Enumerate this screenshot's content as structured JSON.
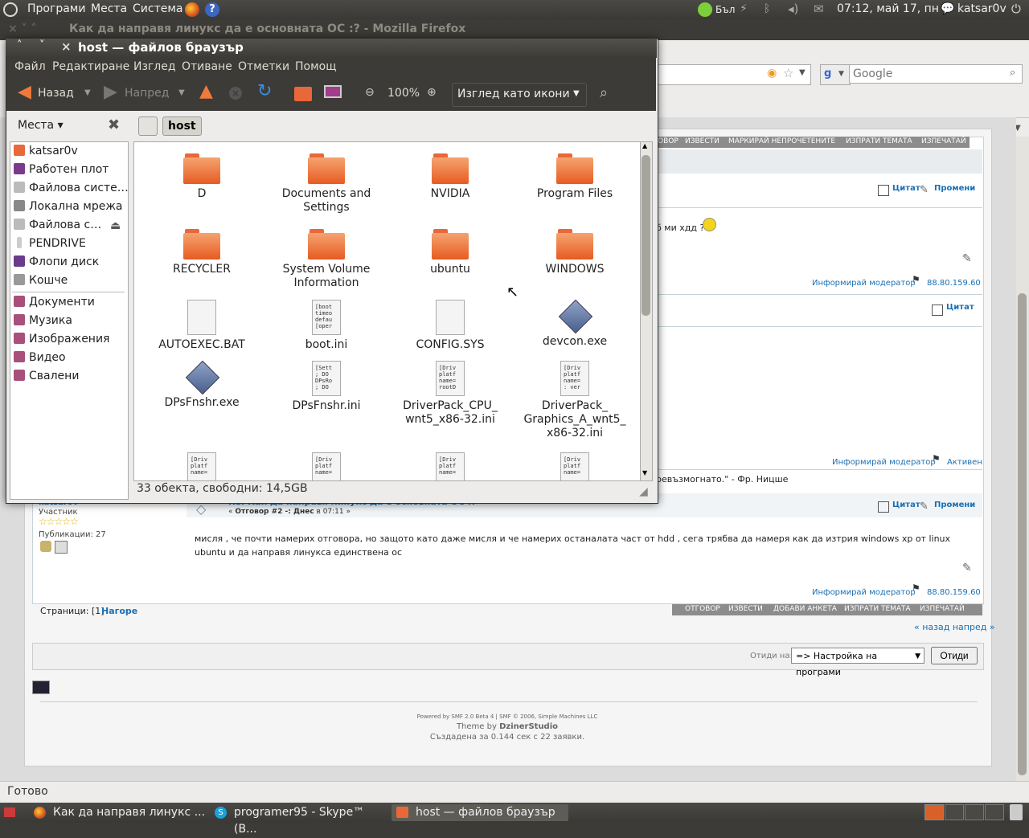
{
  "top_panel": {
    "menus": [
      "Програми",
      "Места",
      "Система"
    ],
    "keyboard": "Бъл",
    "clock": "07:12, май 17, пн",
    "user": "katsar0v"
  },
  "firefox": {
    "title": "Как да направя линукс да е основната ОС :? - Mozilla Firefox",
    "search_placeholder": "Google",
    "status": "Готово",
    "forum": {
      "top_bar_items": [
        "ОВОР",
        "ИЗВЕСТИ",
        "МАРКИРАЙ НЕПРОЧЕТЕНИТЕ",
        "ИЗПРАТИ ТЕМАТА",
        "ИЗПЕЧАТАЙ"
      ],
      "quote": "Цитат",
      "modify": "Промени",
      "post_snippet": "б ми хдд ?",
      "report": "Информирай модератор",
      "ip": "88.80.159.60",
      "active": "Активен",
      "quote_text": "ревъзмогнато.\" - Фр. Ницше",
      "poster_name": "katsar0v",
      "poster_role": "Участник",
      "poster_posts": "Публикации: 27",
      "reply_title": "Re: Как да направя линукс да е основната ОС :?",
      "reply_meta_prefix": "« ",
      "reply_meta_bold": "Отговор #2 -: Днес",
      "reply_meta_rest": " в 07:11 »",
      "reply_body": "мисля , че почти намерих отговора, но защото като даже мисля и че намерих останалата част от hdd , сега трябва да намеря как да изтрия windows xp от linux ubuntu и да направя линукса единствена ос",
      "pages_label": "Страници: [1]",
      "top_link": "Нагоре",
      "bottom_bar_items": [
        "ОТГОВОР",
        "ИЗВЕСТИ",
        "ДОБАВИ АНКЕТА",
        "ИЗПРАТИ ТЕМАТА",
        "ИЗПЕЧАТАЙ"
      ],
      "prev_next": "« назад напред »",
      "jump_label": "Отиди на:",
      "jump_value": "=> Настройка на програми",
      "jump_button": "Отиди",
      "powered": "Powered by SMF 2.0 Beta 4 | SMF © 2006, Simple Machines LLC",
      "theme_prefix": "Theme by ",
      "theme_name": "DzinerStudio",
      "generated": "Създадена за 0.144 сек с 22 заявки."
    }
  },
  "nautilus": {
    "title": "host — файлов браузър",
    "menu": [
      "Файл",
      "Редактиране",
      "Изглед",
      "Отиване",
      "Отметки",
      "Помощ"
    ],
    "back": "Назад",
    "forward": "Напред",
    "zoom": "100%",
    "view_mode": "Изглед като икони",
    "location": "host",
    "places_label": "Места",
    "places": [
      "katsar0v",
      "Работен плот",
      "Файлова систе…",
      "Локална мрежа",
      "Файлова с…",
      "PENDRIVE",
      "Флопи диск",
      "Кошче"
    ],
    "bookmarks": [
      "Документи",
      "Музика",
      "Изображения",
      "Видео",
      "Свалени"
    ],
    "files": [
      {
        "name": "D",
        "type": "folder"
      },
      {
        "name": "Documents and Settings",
        "type": "folder"
      },
      {
        "name": "NVIDIA",
        "type": "folder"
      },
      {
        "name": "Program Files",
        "type": "folder"
      },
      {
        "name": "RECYCLER",
        "type": "folder"
      },
      {
        "name": "System Volume Information",
        "type": "folder"
      },
      {
        "name": "ubuntu",
        "type": "folder"
      },
      {
        "name": "WINDOWS",
        "type": "folder"
      },
      {
        "name": "AUTOEXEC.BAT",
        "type": "doc",
        "preview": ""
      },
      {
        "name": "boot.ini",
        "type": "doc",
        "preview": "[boot timeo defau [oper"
      },
      {
        "name": "CONFIG.SYS",
        "type": "doc",
        "preview": ""
      },
      {
        "name": "devcon.exe",
        "type": "exe"
      },
      {
        "name": "DPsFnshr.exe",
        "type": "exe"
      },
      {
        "name": "DPsFnshr.ini",
        "type": "doc",
        "preview": "[Sett ; DO DPsRo ; DO"
      },
      {
        "name": "DriverPack_CPU_ wnt5_x86-32.ini",
        "type": "doc",
        "preview": "[Driv platf name= rootD"
      },
      {
        "name": "DriverPack_ Graphics_A_wnt5_ x86-32.ini",
        "type": "doc",
        "preview": "[Driv platf name= : ver"
      },
      {
        "name": "",
        "type": "doc",
        "preview": "[Driv platf name="
      },
      {
        "name": "",
        "type": "doc",
        "preview": "[Driv platf name="
      },
      {
        "name": "",
        "type": "doc",
        "preview": "[Driv platf name="
      },
      {
        "name": "",
        "type": "doc",
        "preview": "[Driv platf name="
      }
    ],
    "status": "33 обекта, свободни: 14,5GB"
  },
  "taskbar": {
    "tasks": [
      "Как да направя линукс ...",
      "programer95 - Skype™ (B...",
      "host — файлов браузър"
    ]
  },
  "colors": {
    "panel": "#3c3b37",
    "folder": "#e65b22",
    "link": "#1b6fb3"
  }
}
